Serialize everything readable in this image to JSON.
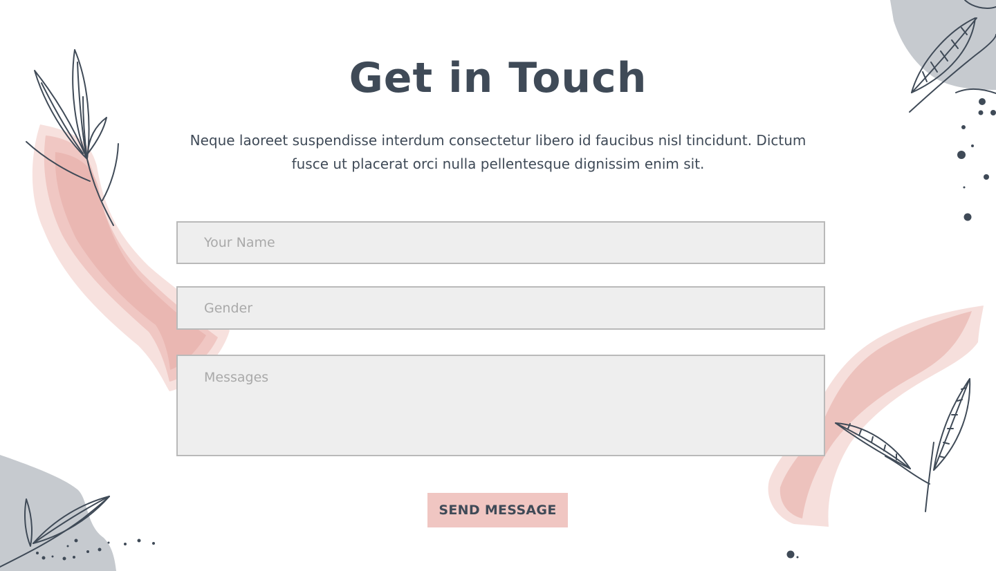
{
  "page": {
    "title": "Get in Touch",
    "subtitle": "Neque laoreet suspendisse interdum consectetur libero id faucibus nisl tincidunt. Dictum fusce ut placerat orci nulla pellentesque dignissim enim sit."
  },
  "form": {
    "name_placeholder": "Your Name",
    "name_value": "",
    "gender_placeholder": "Gender",
    "gender_value": "",
    "messages_placeholder": "Messages",
    "messages_value": "",
    "submit_label": "SEND MESSAGE"
  },
  "decorations": {
    "brush_stroke": "pink-watercolor-brush-stroke",
    "leaves": "line-art-leaf-branch-icon",
    "blob": "gray-blob-shape",
    "dots": "scattered-dots"
  },
  "colors": {
    "text": "#3f4a57",
    "field_background": "#eeeeee",
    "field_border": "#b9b9b9",
    "button_background": "#f0c6c2",
    "brush_pink": "#eab8b3",
    "blob_gray": "#c6cacf",
    "placeholder": "#a9a9a9"
  }
}
